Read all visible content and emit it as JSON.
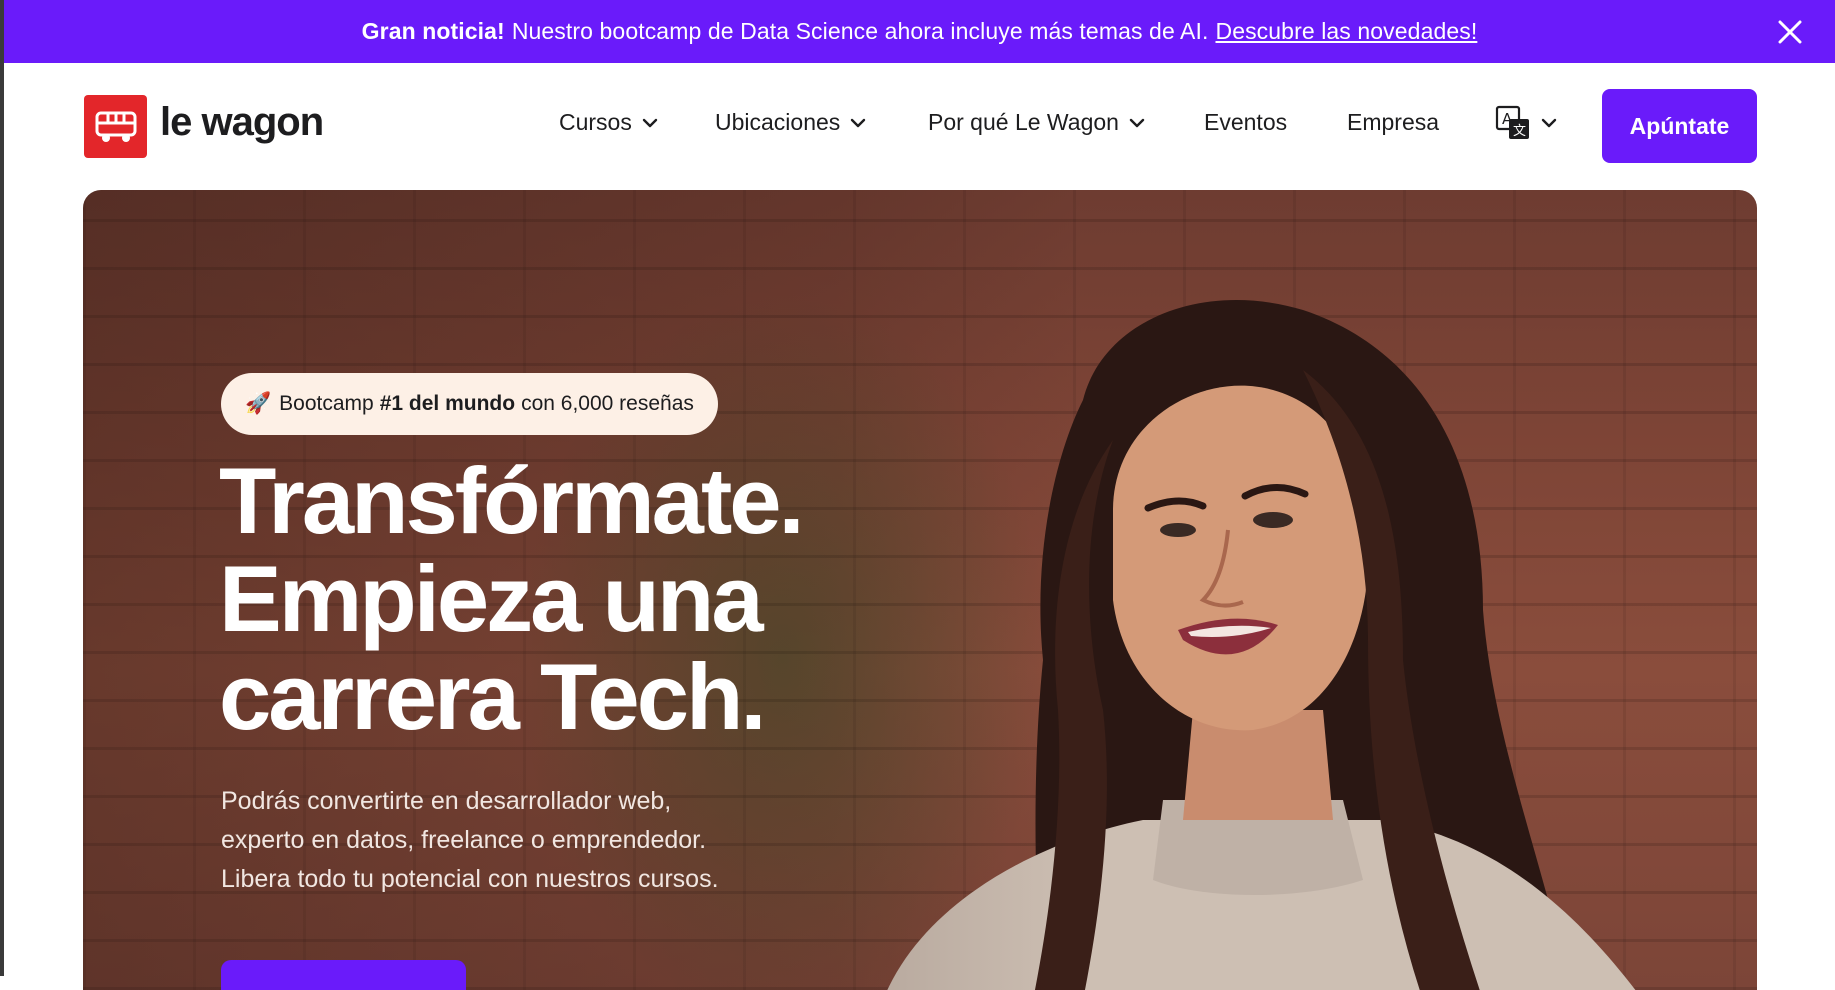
{
  "announcement": {
    "bold": "Gran noticia!",
    "text": "Nuestro bootcamp de Data Science ahora incluye más temas de AI.",
    "link": "Descubre las novedades!"
  },
  "header": {
    "logo_text": "le wagon",
    "nav": [
      "Cursos",
      "Ubicaciones",
      "Por qué Le Wagon",
      "Eventos",
      "Empresa"
    ],
    "cta": "Apúntate"
  },
  "hero": {
    "badge": {
      "prefix": "Bootcamp",
      "bold": "#1 del mundo",
      "suffix": "con 6,000 reseñas"
    },
    "headline": [
      "Transfórmate.",
      "Empieza una",
      "carrera Tech."
    ],
    "subtext": "Podrás convertirte en desarrollador web, experto en datos, freelance o emprendedor. Libera todo tu potencial con nuestros cursos."
  },
  "colors": {
    "brand_purple": "#6a1bfa",
    "logo_red": "#e3262a",
    "badge_bg": "#fdf0e6"
  },
  "icons": {
    "close": "close-icon",
    "chevron": "chevron-down-icon",
    "translate": "translate-icon",
    "bus": "bus-icon",
    "rocket": "rocket-icon"
  }
}
